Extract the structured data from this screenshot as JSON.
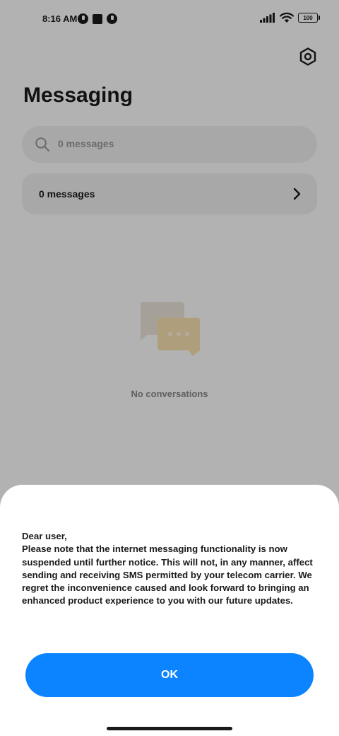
{
  "status_bar": {
    "time": "8:16 AM",
    "battery": "100",
    "icons_left": [
      "app-notification-icon",
      "square-notification-icon",
      "app-notification-icon"
    ],
    "icons_right": [
      "signal-icon",
      "wifi-icon",
      "battery-icon"
    ]
  },
  "header": {
    "title": "Messaging",
    "settings_icon": "gear-icon"
  },
  "search": {
    "placeholder": "0 messages",
    "icon": "search-icon"
  },
  "messages_row": {
    "label": "0 messages",
    "icon": "chevron-right-icon"
  },
  "empty_state": {
    "text": "No conversations",
    "icon": "chat-bubbles-icon"
  },
  "dialog": {
    "message": "Dear user,\nPlease note that the internet messaging functionality is now suspended until further notice. This will not, in any manner, affect sending and receiving SMS permitted by your telecom carrier. We regret the inconvenience caused and look forward to bringing an enhanced product experience to you with our future updates.",
    "ok_label": "OK"
  },
  "colors": {
    "accent": "#0d84ff",
    "scrim": "rgba(0,0,0,0.3)",
    "card": "#f1f1f1",
    "illustration_back": "#eee7da",
    "illustration_front": "#fbe2b0"
  }
}
